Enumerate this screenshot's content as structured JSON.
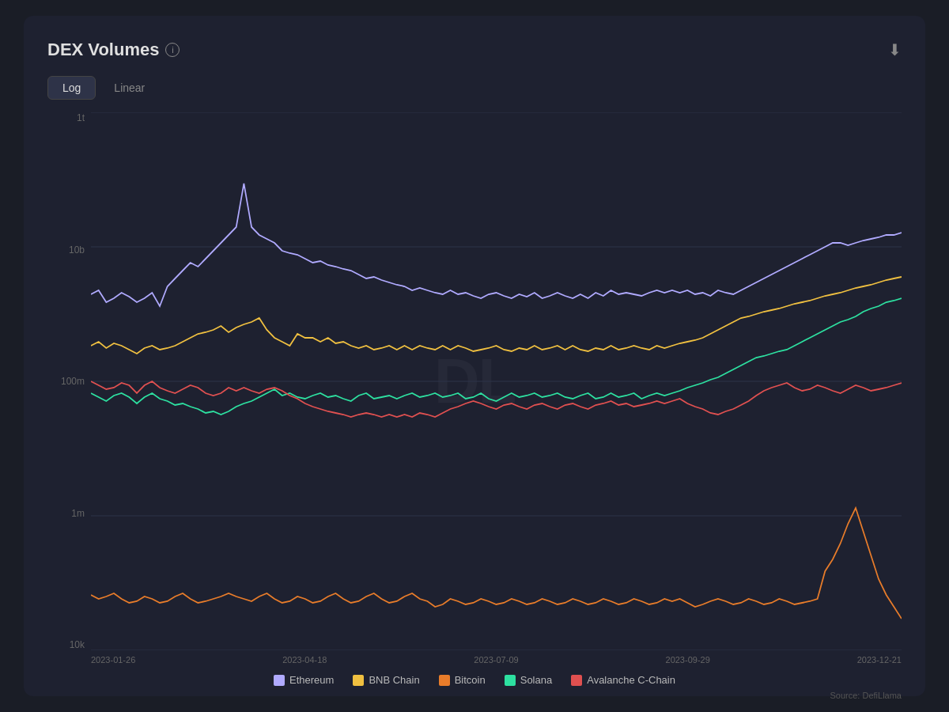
{
  "header": {
    "title": "DEX Volumes",
    "info_label": "i",
    "download_label": "⬇"
  },
  "toggle": {
    "log_label": "Log",
    "linear_label": "Linear",
    "active": "log"
  },
  "y_axis": {
    "labels": [
      "1t",
      "10b",
      "100m",
      "1m",
      "10k"
    ]
  },
  "x_axis": {
    "labels": [
      "2023-01-26",
      "2023-04-18",
      "2023-07-09",
      "2023-09-29",
      "2023-12-21"
    ]
  },
  "legend": {
    "items": [
      {
        "name": "Ethereum",
        "color": "#b0aaff"
      },
      {
        "name": "BNB Chain",
        "color": "#f0c040"
      },
      {
        "name": "Bitcoin",
        "color": "#e87c2a"
      },
      {
        "name": "Solana",
        "color": "#2de0a0"
      },
      {
        "name": "Avalanche C-Chain",
        "color": "#e05050"
      }
    ]
  },
  "source": "Source: DefiLlama",
  "watermark": "DL"
}
